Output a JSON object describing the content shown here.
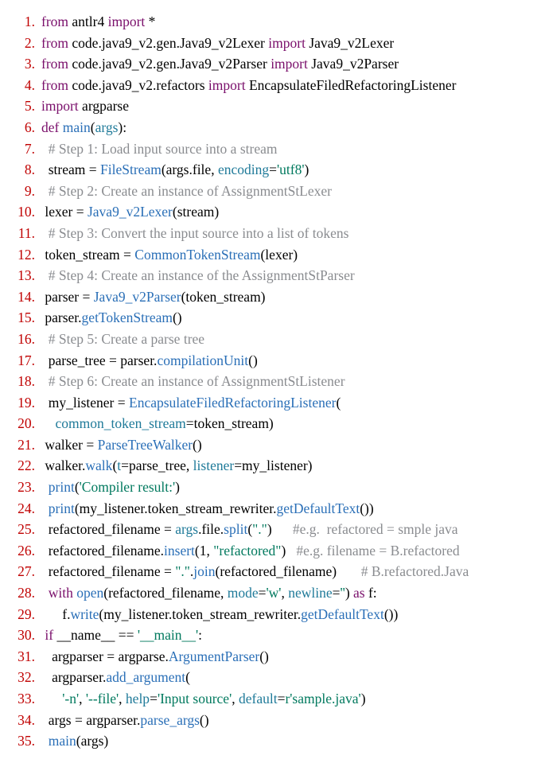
{
  "lines": [
    {
      "n": "1.",
      "indent": "",
      "tokens": [
        {
          "c": "kw",
          "t": "from"
        },
        {
          "c": "nm",
          "t": " antlr4 "
        },
        {
          "c": "kw",
          "t": "import"
        },
        {
          "c": "nm",
          "t": " *"
        }
      ]
    },
    {
      "n": "2.",
      "indent": "",
      "tokens": [
        {
          "c": "kw",
          "t": "from"
        },
        {
          "c": "nm",
          "t": " code.java9_v2.gen.Java9_v2Lexer "
        },
        {
          "c": "kw",
          "t": "import"
        },
        {
          "c": "nm",
          "t": " Java9_v2Lexer"
        }
      ]
    },
    {
      "n": "3.",
      "indent": "",
      "tokens": [
        {
          "c": "kw",
          "t": "from"
        },
        {
          "c": "nm",
          "t": " code.java9_v2.gen.Java9_v2Parser "
        },
        {
          "c": "kw",
          "t": "import"
        },
        {
          "c": "nm",
          "t": " Java9_v2Parser"
        }
      ]
    },
    {
      "n": "4.",
      "indent": "",
      "tokens": [
        {
          "c": "kw",
          "t": "from"
        },
        {
          "c": "nm",
          "t": " code.java9_v2.refactors "
        },
        {
          "c": "kw",
          "t": "import"
        },
        {
          "c": "nm",
          "t": " EncapsulateFiledRefactoringListener"
        }
      ]
    },
    {
      "n": "5.",
      "indent": "",
      "tokens": [
        {
          "c": "kw",
          "t": "import"
        },
        {
          "c": "nm",
          "t": " argparse"
        }
      ]
    },
    {
      "n": "6.",
      "indent": "",
      "tokens": [
        {
          "c": "kw",
          "t": "def"
        },
        {
          "c": "nm",
          "t": " "
        },
        {
          "c": "fn",
          "t": "main"
        },
        {
          "c": "nm",
          "t": "("
        },
        {
          "c": "name",
          "t": "args"
        },
        {
          "c": "nm",
          "t": "):"
        }
      ]
    },
    {
      "n": "7.",
      "indent": "  ",
      "tokens": [
        {
          "c": "cm",
          "t": "# Step 1: Load input source into a stream"
        }
      ]
    },
    {
      "n": "8.",
      "indent": "  ",
      "tokens": [
        {
          "c": "nm",
          "t": "stream = "
        },
        {
          "c": "fn",
          "t": "FileStream"
        },
        {
          "c": "nm",
          "t": "(args.file, "
        },
        {
          "c": "name",
          "t": "encoding"
        },
        {
          "c": "nm",
          "t": "="
        },
        {
          "c": "str",
          "t": "'utf8'"
        },
        {
          "c": "nm",
          "t": ")"
        }
      ]
    },
    {
      "n": "9.",
      "indent": "  ",
      "tokens": [
        {
          "c": "cm",
          "t": "# Step 2: Create an instance of AssignmentStLexer"
        }
      ]
    },
    {
      "n": "10.",
      "indent": " ",
      "tokens": [
        {
          "c": "nm",
          "t": "lexer = "
        },
        {
          "c": "fn",
          "t": "Java9_v2Lexer"
        },
        {
          "c": "nm",
          "t": "(stream)"
        }
      ]
    },
    {
      "n": "11.",
      "indent": "  ",
      "tokens": [
        {
          "c": "cm",
          "t": "# Step 3: Convert the input source into a list of tokens"
        }
      ]
    },
    {
      "n": "12.",
      "indent": " ",
      "tokens": [
        {
          "c": "nm",
          "t": "token_stream = "
        },
        {
          "c": "fn",
          "t": "CommonTokenStream"
        },
        {
          "c": "nm",
          "t": "(lexer)"
        }
      ]
    },
    {
      "n": "13.",
      "indent": "  ",
      "tokens": [
        {
          "c": "cm",
          "t": "# Step 4: Create an instance of the AssignmentStParser"
        }
      ]
    },
    {
      "n": "14.",
      "indent": " ",
      "tokens": [
        {
          "c": "nm",
          "t": "parser = "
        },
        {
          "c": "fn",
          "t": "Java9_v2Parser"
        },
        {
          "c": "nm",
          "t": "(token_stream)"
        }
      ]
    },
    {
      "n": "15.",
      "indent": " ",
      "tokens": [
        {
          "c": "nm",
          "t": "parser."
        },
        {
          "c": "fn",
          "t": "getTokenStream"
        },
        {
          "c": "nm",
          "t": "()"
        }
      ]
    },
    {
      "n": "16.",
      "indent": "  ",
      "tokens": [
        {
          "c": "cm",
          "t": "# Step 5: Create a parse tree"
        }
      ]
    },
    {
      "n": "17.",
      "indent": "  ",
      "tokens": [
        {
          "c": "nm",
          "t": "parse_tree = parser."
        },
        {
          "c": "fn",
          "t": "compilationUnit"
        },
        {
          "c": "nm",
          "t": "()"
        }
      ]
    },
    {
      "n": "18.",
      "indent": "  ",
      "tokens": [
        {
          "c": "cm",
          "t": "# Step 6: Create an instance of AssignmentStListener"
        }
      ]
    },
    {
      "n": "19.",
      "indent": "  ",
      "tokens": [
        {
          "c": "nm",
          "t": "my_listener = "
        },
        {
          "c": "fn",
          "t": "EncapsulateFiledRefactoringListener"
        },
        {
          "c": "nm",
          "t": "("
        }
      ]
    },
    {
      "n": "20.",
      "indent": "    ",
      "tokens": [
        {
          "c": "name",
          "t": "common_token_stream"
        },
        {
          "c": "nm",
          "t": "=token_stream)"
        }
      ]
    },
    {
      "n": "21.",
      "indent": " ",
      "tokens": [
        {
          "c": "nm",
          "t": "walker = "
        },
        {
          "c": "fn",
          "t": "ParseTreeWalker"
        },
        {
          "c": "nm",
          "t": "()"
        }
      ]
    },
    {
      "n": "22.",
      "indent": " ",
      "tokens": [
        {
          "c": "nm",
          "t": "walker."
        },
        {
          "c": "fn",
          "t": "walk"
        },
        {
          "c": "nm",
          "t": "("
        },
        {
          "c": "name",
          "t": "t"
        },
        {
          "c": "nm",
          "t": "=parse_tree, "
        },
        {
          "c": "name",
          "t": "listener"
        },
        {
          "c": "nm",
          "t": "=my_listener)"
        }
      ]
    },
    {
      "n": "23.",
      "indent": "  ",
      "tokens": [
        {
          "c": "fn",
          "t": "print"
        },
        {
          "c": "nm",
          "t": "("
        },
        {
          "c": "str",
          "t": "'Compiler result:'"
        },
        {
          "c": "nm",
          "t": ")"
        }
      ]
    },
    {
      "n": "24.",
      "indent": "  ",
      "tokens": [
        {
          "c": "fn",
          "t": "print"
        },
        {
          "c": "nm",
          "t": "(my_listener.token_stream_rewriter."
        },
        {
          "c": "fn",
          "t": "getDefaultText"
        },
        {
          "c": "nm",
          "t": "())"
        }
      ]
    },
    {
      "n": "25.",
      "indent": "  ",
      "tokens": [
        {
          "c": "nm",
          "t": "refactored_filename = "
        },
        {
          "c": "name",
          "t": "args"
        },
        {
          "c": "nm",
          "t": ".file."
        },
        {
          "c": "fn",
          "t": "split"
        },
        {
          "c": "nm",
          "t": "("
        },
        {
          "c": "str",
          "t": "\".\""
        },
        {
          "c": "nm",
          "t": ")      "
        },
        {
          "c": "cm",
          "t": "#e.g.  refactored = smple java"
        }
      ]
    },
    {
      "n": "26.",
      "indent": "  ",
      "tokens": [
        {
          "c": "nm",
          "t": "refactored_filename."
        },
        {
          "c": "fn",
          "t": "insert"
        },
        {
          "c": "nm",
          "t": "(1, "
        },
        {
          "c": "str",
          "t": "\"refactored\""
        },
        {
          "c": "nm",
          "t": ")   "
        },
        {
          "c": "cm",
          "t": "#e.g. filename = B.refactored"
        }
      ]
    },
    {
      "n": "27.",
      "indent": "  ",
      "tokens": [
        {
          "c": "nm",
          "t": "refactored_filename = "
        },
        {
          "c": "str",
          "t": "\".\""
        },
        {
          "c": "nm",
          "t": "."
        },
        {
          "c": "fn",
          "t": "join"
        },
        {
          "c": "nm",
          "t": "(refactored_filename)       "
        },
        {
          "c": "cm",
          "t": "# B.refactored.Java"
        }
      ]
    },
    {
      "n": "28.",
      "indent": "  ",
      "tokens": [
        {
          "c": "kw",
          "t": "with"
        },
        {
          "c": "nm",
          "t": " "
        },
        {
          "c": "fn",
          "t": "open"
        },
        {
          "c": "nm",
          "t": "(refactored_filename, "
        },
        {
          "c": "name",
          "t": "mode"
        },
        {
          "c": "nm",
          "t": "="
        },
        {
          "c": "str",
          "t": "'w'"
        },
        {
          "c": "nm",
          "t": ", "
        },
        {
          "c": "name",
          "t": "newline"
        },
        {
          "c": "nm",
          "t": "="
        },
        {
          "c": "str",
          "t": "''"
        },
        {
          "c": "nm",
          "t": ") "
        },
        {
          "c": "kw",
          "t": "as"
        },
        {
          "c": "nm",
          "t": " f:"
        }
      ]
    },
    {
      "n": "29.",
      "indent": "      ",
      "tokens": [
        {
          "c": "nm",
          "t": "f."
        },
        {
          "c": "fn",
          "t": "write"
        },
        {
          "c": "nm",
          "t": "(my_listener.token_stream_rewriter."
        },
        {
          "c": "fn",
          "t": "getDefaultText"
        },
        {
          "c": "nm",
          "t": "())"
        }
      ]
    },
    {
      "n": "30.",
      "indent": " ",
      "tokens": [
        {
          "c": "kw",
          "t": "if"
        },
        {
          "c": "nm",
          "t": " __name__ == "
        },
        {
          "c": "str",
          "t": "'__main__'"
        },
        {
          "c": "nm",
          "t": ":"
        }
      ]
    },
    {
      "n": "31.",
      "indent": "   ",
      "tokens": [
        {
          "c": "nm",
          "t": "argparser = argparse."
        },
        {
          "c": "fn",
          "t": "ArgumentParser"
        },
        {
          "c": "nm",
          "t": "()"
        }
      ]
    },
    {
      "n": "32.",
      "indent": "   ",
      "tokens": [
        {
          "c": "nm",
          "t": "argparser."
        },
        {
          "c": "fn",
          "t": "add_argument"
        },
        {
          "c": "nm",
          "t": "("
        }
      ]
    },
    {
      "n": "33.",
      "indent": "      ",
      "tokens": [
        {
          "c": "str",
          "t": "'-n'"
        },
        {
          "c": "nm",
          "t": ", "
        },
        {
          "c": "str",
          "t": "'--file'"
        },
        {
          "c": "nm",
          "t": ", "
        },
        {
          "c": "name",
          "t": "help"
        },
        {
          "c": "nm",
          "t": "="
        },
        {
          "c": "str",
          "t": "'Input source'"
        },
        {
          "c": "nm",
          "t": ", "
        },
        {
          "c": "name",
          "t": "default"
        },
        {
          "c": "nm",
          "t": "="
        },
        {
          "c": "str",
          "t": "r'sample.java'"
        },
        {
          "c": "nm",
          "t": ")"
        }
      ]
    },
    {
      "n": "34.",
      "indent": "  ",
      "tokens": [
        {
          "c": "nm",
          "t": "args = argparser."
        },
        {
          "c": "fn",
          "t": "parse_args"
        },
        {
          "c": "nm",
          "t": "()"
        }
      ]
    },
    {
      "n": "35.",
      "indent": "  ",
      "tokens": [
        {
          "c": "fn",
          "t": "main"
        },
        {
          "c": "nm",
          "t": "(args)"
        }
      ]
    }
  ]
}
